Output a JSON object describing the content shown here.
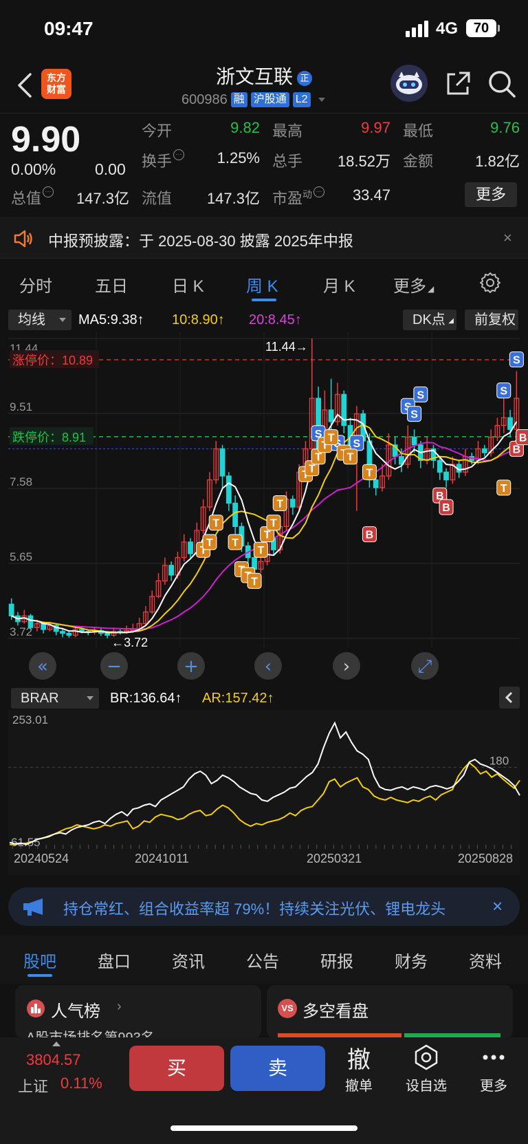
{
  "status": {
    "time": "09:47",
    "network": "4G",
    "battery": "70"
  },
  "header": {
    "logo": "东方\n财富",
    "stock_name": "浙文互联",
    "zheng_badge": "正",
    "code": "600986",
    "tags": [
      "融",
      "沪股通",
      "L2"
    ]
  },
  "quote": {
    "price": "9.90",
    "change_pct": "0.00%",
    "change_abs": "0.00",
    "fields": [
      {
        "label": "今开",
        "value": "9.82",
        "color": "green"
      },
      {
        "label": "最高",
        "value": "9.97",
        "color": "red"
      },
      {
        "label": "最低",
        "value": "9.76",
        "color": "green"
      },
      {
        "label": "换手",
        "value": "1.25%",
        "color": "white"
      },
      {
        "label": "总手",
        "value": "18.52万",
        "color": "white"
      },
      {
        "label": "金额",
        "value": "1.82亿",
        "color": "white"
      },
      {
        "label": "总值",
        "value": "147.3亿",
        "color": "white"
      },
      {
        "label": "流值",
        "value": "147.3亿",
        "color": "white"
      },
      {
        "label": "市盈",
        "superscript": "动",
        "value": "33.47",
        "color": "white"
      }
    ],
    "more_label": "更多"
  },
  "notice": {
    "text": "中报预披露：于 2025-08-30 披露 2025年中报",
    "close": "×"
  },
  "tabs": [
    "分时",
    "五日",
    "日 K",
    "周 K",
    "月 K",
    "更多"
  ],
  "active_tab": "周 K",
  "ma_row": {
    "selector": "均线",
    "ma5": "MA5:9.38↑",
    "ma10": "10:8.90↑",
    "ma20": "20:8.45↑",
    "dk": "DK点",
    "fq": "前复权"
  },
  "colors": {
    "up": "#f23b3b",
    "down": "#22d3d3",
    "ma5": "#ffffff",
    "ma10": "#f5d000",
    "ma20": "#d020d0",
    "accent": "#3c8cf0"
  },
  "chart_data": [
    {
      "type": "candlestick",
      "y_labels": [
        "11.44",
        "9.51",
        "7.58",
        "5.65",
        "3.72"
      ],
      "ylim": [
        3.72,
        11.44
      ],
      "limit_up": {
        "label": "涨停价：10.89",
        "value": 10.89
      },
      "limit_down": {
        "label": "跌停价：8.91",
        "value": 8.91
      },
      "max_label": "11.44→",
      "min_label": "←3.72",
      "reference_price": 8.6,
      "candles": [
        [
          4.6,
          4.3,
          4.75,
          4.2
        ],
        [
          4.3,
          4.15,
          4.4,
          4.05
        ],
        [
          4.15,
          4.3,
          4.45,
          4.1
        ],
        [
          4.3,
          4.0,
          4.35,
          3.95
        ],
        [
          4.0,
          4.1,
          4.2,
          3.9
        ],
        [
          4.1,
          3.95,
          4.15,
          3.85
        ],
        [
          3.95,
          4.05,
          4.15,
          3.9
        ],
        [
          4.05,
          3.9,
          4.1,
          3.8
        ],
        [
          3.9,
          3.85,
          3.95,
          3.75
        ],
        [
          3.85,
          3.8,
          3.9,
          3.74
        ],
        [
          3.8,
          3.95,
          4.05,
          3.75
        ],
        [
          3.95,
          3.9,
          4.0,
          3.85
        ],
        [
          3.9,
          3.88,
          3.95,
          3.8
        ],
        [
          3.88,
          3.92,
          4.0,
          3.82
        ],
        [
          3.92,
          3.85,
          3.98,
          3.78
        ],
        [
          3.85,
          3.8,
          3.9,
          3.72
        ],
        [
          3.8,
          3.9,
          4.0,
          3.76
        ],
        [
          3.9,
          3.88,
          3.95,
          3.82
        ],
        [
          3.88,
          3.92,
          4.05,
          3.84
        ],
        [
          3.92,
          3.95,
          4.1,
          3.86
        ],
        [
          3.95,
          4.1,
          4.25,
          3.9
        ],
        [
          4.1,
          4.4,
          4.55,
          4.05
        ],
        [
          4.4,
          4.8,
          4.95,
          4.35
        ],
        [
          4.8,
          5.2,
          5.4,
          4.75
        ],
        [
          5.2,
          5.6,
          5.8,
          5.1
        ],
        [
          5.6,
          5.35,
          5.7,
          5.2
        ],
        [
          5.35,
          5.8,
          5.95,
          5.25
        ],
        [
          5.8,
          6.2,
          6.4,
          5.7
        ],
        [
          6.2,
          5.9,
          6.3,
          5.75
        ],
        [
          5.9,
          6.5,
          6.7,
          5.85
        ],
        [
          6.5,
          7.1,
          7.3,
          6.4
        ],
        [
          7.1,
          7.8,
          8.0,
          7.0
        ],
        [
          7.8,
          8.6,
          8.8,
          7.7
        ],
        [
          8.6,
          7.9,
          8.7,
          7.6
        ],
        [
          7.9,
          7.2,
          8.0,
          7.0
        ],
        [
          7.2,
          6.6,
          7.4,
          6.4
        ],
        [
          6.6,
          6.1,
          6.7,
          5.95
        ],
        [
          6.1,
          5.8,
          6.2,
          5.6
        ],
        [
          5.8,
          5.5,
          5.9,
          5.3
        ],
        [
          5.5,
          5.7,
          5.9,
          5.4
        ],
        [
          5.7,
          6.3,
          6.5,
          5.6
        ],
        [
          6.3,
          6.0,
          6.4,
          5.85
        ],
        [
          6.0,
          6.6,
          6.8,
          5.9
        ],
        [
          6.6,
          7.3,
          7.5,
          6.5
        ],
        [
          7.3,
          7.1,
          7.4,
          6.9
        ],
        [
          7.1,
          8.0,
          8.2,
          7.0
        ],
        [
          8.0,
          8.6,
          8.8,
          7.9
        ],
        [
          8.6,
          9.9,
          11.44,
          8.5
        ],
        [
          9.9,
          8.6,
          10.2,
          8.4
        ],
        [
          8.6,
          9.6,
          10.1,
          8.5
        ],
        [
          9.6,
          9.3,
          10.4,
          9.1
        ],
        [
          9.3,
          10.0,
          10.3,
          9.2
        ],
        [
          10.0,
          9.2,
          10.1,
          9.0
        ],
        [
          9.2,
          8.7,
          9.4,
          8.5
        ],
        [
          8.7,
          9.5,
          9.7,
          7.0
        ],
        [
          9.5,
          8.8,
          9.6,
          8.6
        ],
        [
          8.8,
          7.8,
          9.0,
          7.6
        ],
        [
          7.8,
          7.6,
          8.0,
          7.4
        ],
        [
          7.6,
          7.9,
          8.2,
          7.5
        ],
        [
          7.9,
          8.7,
          9.0,
          7.8
        ],
        [
          8.7,
          8.4,
          8.9,
          8.2
        ],
        [
          8.4,
          8.2,
          8.6,
          8.0
        ],
        [
          8.2,
          8.9,
          9.2,
          8.1
        ],
        [
          8.9,
          8.7,
          9.1,
          8.5
        ],
        [
          8.7,
          8.3,
          8.8,
          8.1
        ],
        [
          8.3,
          8.6,
          8.9,
          8.2
        ],
        [
          8.6,
          8.3,
          8.7,
          8.1
        ],
        [
          8.3,
          8.0,
          8.4,
          7.8
        ],
        [
          8.0,
          7.8,
          8.1,
          7.6
        ],
        [
          7.8,
          8.2,
          8.4,
          7.7
        ],
        [
          8.2,
          8.0,
          8.3,
          7.85
        ],
        [
          8.0,
          8.4,
          8.6,
          7.9
        ],
        [
          8.4,
          8.3,
          8.5,
          8.2
        ],
        [
          8.3,
          8.6,
          8.8,
          8.2
        ],
        [
          8.6,
          8.5,
          8.7,
          8.4
        ],
        [
          8.5,
          8.9,
          9.1,
          8.4
        ],
        [
          8.9,
          9.2,
          9.4,
          8.8
        ],
        [
          9.2,
          9.4,
          10.2,
          9.0
        ],
        [
          9.4,
          9.1,
          9.6,
          8.9
        ],
        [
          9.1,
          9.9,
          10.6,
          9.0
        ]
      ],
      "signals": {
        "S": [
          [
            48,
            9.0
          ],
          [
            51,
            8.75
          ],
          [
            54,
            8.75
          ],
          [
            62,
            9.7
          ],
          [
            63,
            9.5
          ],
          [
            64,
            10.0
          ],
          [
            77,
            10.1
          ],
          [
            79,
            10.9
          ]
        ],
        "T": [
          [
            30,
            6.0
          ],
          [
            31,
            6.2
          ],
          [
            32,
            6.7
          ],
          [
            35,
            6.2
          ],
          [
            36,
            5.5
          ],
          [
            37,
            5.35
          ],
          [
            38,
            5.2
          ],
          [
            39,
            6.0
          ],
          [
            40,
            6.4
          ],
          [
            41,
            6.7
          ],
          [
            42,
            7.2
          ],
          [
            46,
            7.95
          ],
          [
            47,
            8.1
          ],
          [
            48,
            8.4
          ],
          [
            49,
            8.7
          ],
          [
            50,
            8.9
          ],
          [
            52,
            8.5
          ],
          [
            53,
            8.4
          ],
          [
            56,
            8.0
          ],
          [
            77,
            7.6
          ]
        ],
        "B": [
          [
            56,
            6.4
          ],
          [
            67,
            7.4
          ],
          [
            68,
            7.1
          ],
          [
            79,
            8.6
          ],
          [
            80,
            8.9
          ]
        ]
      }
    },
    {
      "type": "line",
      "title": "BRAR",
      "br_label": "BR:136.64↑",
      "ar_label": "AR:157.42↑",
      "y_labels": [
        "253.01",
        "180",
        "61.55"
      ],
      "ylim": [
        61.55,
        253.01
      ],
      "x_labels": [
        "20240524",
        "20241011",
        "20250321",
        "20250828"
      ],
      "br": [
        65,
        63,
        64,
        62,
        66,
        70,
        72,
        74,
        78,
        80,
        78,
        84,
        88,
        90,
        92,
        96,
        98,
        94,
        102,
        108,
        112,
        106,
        116,
        118,
        122,
        124,
        120,
        130,
        135,
        140,
        145,
        150,
        162,
        170,
        174,
        168,
        155,
        160,
        168,
        164,
        158,
        150,
        145,
        140,
        138,
        130,
        128,
        134,
        138,
        142,
        148,
        150,
        158,
        166,
        172,
        185,
        210,
        232,
        248,
        225,
        234,
        218,
        205,
        200,
        192,
        166,
        150,
        146,
        145,
        148,
        150,
        146,
        150,
        148,
        145,
        150,
        152,
        150,
        147,
        150,
        158,
        168,
        188,
        192,
        185,
        182,
        178,
        172,
        166,
        160,
        152,
        137
      ]
    }
  ],
  "brar_extra": {
    "ar": [
      62,
      62,
      63,
      64,
      66,
      70,
      72,
      75,
      78,
      82,
      86,
      88,
      92,
      90,
      88,
      86,
      88,
      92,
      90,
      94,
      96,
      98,
      86,
      90,
      98,
      96,
      104,
      108,
      106,
      104,
      100,
      102,
      108,
      112,
      114,
      106,
      108,
      116,
      122,
      118,
      110,
      100,
      94,
      90,
      94,
      92,
      96,
      98,
      100,
      104,
      110,
      106,
      114,
      118,
      120,
      130,
      140,
      158,
      162,
      150,
      156,
      160,
      164,
      150,
      146,
      136,
      132,
      130,
      134,
      130,
      128,
      126,
      130,
      128,
      133,
      136,
      130,
      138,
      142,
      146,
      166,
      178,
      187,
      180,
      170,
      174,
      165,
      170,
      162,
      155,
      148,
      160
    ]
  },
  "banner": {
    "text": "持仓常红、组合收益率超 79%！持续关注光伏、锂电龙头",
    "close": "×"
  },
  "bottom_tabs": [
    "股吧",
    "盘口",
    "资讯",
    "公告",
    "研报",
    "财务",
    "资料"
  ],
  "cards": [
    {
      "title": "人气榜",
      "sub": "A股市场排名第993名"
    },
    {
      "title": "多空看盘"
    }
  ],
  "action": {
    "index_value": "3804.57",
    "index_name": "上证",
    "index_pct": "0.11%",
    "buy": "买",
    "sell": "卖",
    "cancel_glyph": "撤",
    "cancel": "撤单",
    "watch": "设自选",
    "more": "更多"
  }
}
